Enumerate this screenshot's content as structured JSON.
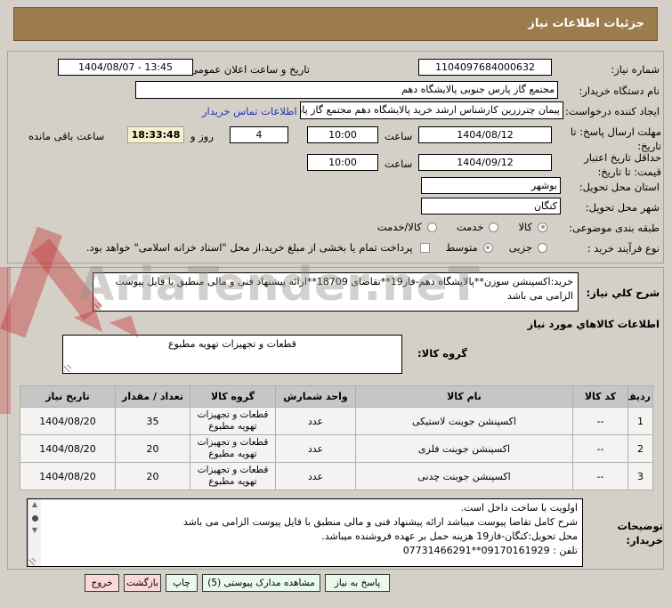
{
  "colors": {
    "header_bg": "#9c7b4c",
    "link_blue": "#2233bb",
    "countdown_highlight": "#f5f0cd",
    "button_green": "#e9f9ec",
    "button_pink": "#fbd9d9",
    "watermark_red": "#c63c3c",
    "table_header_bg": "#c6c6c6"
  },
  "header": {
    "title": "جزئیات اطلاعات نیاز"
  },
  "watermark": {
    "text": "AriaTender.neT"
  },
  "info": {
    "need_number_label": "شماره نیاز:",
    "need_number": "1104097684000632",
    "announce_label": "تاریخ و ساعت اعلان عمومی:",
    "announce_value": "1404/08/07 - 13:45",
    "buyer_org_label": "نام دستگاه خریدار:",
    "buyer_org": "مجتمع گاز پارس جنوبی  پالایشگاه دهم",
    "creator_label": "ایجاد کننده درخواست:",
    "creator": "پیمان چترزرین کارشناس ارشد خرید پالایشگاه دهم مجتمع گاز پارس جنوبی  پالا",
    "contact_link": "اطلاعات تماس خریدار",
    "deadline_label": "مهلت ارسال پاسخ: تا تاریخ:",
    "deadline_date": "1404/08/12",
    "hour_label": "ساعت",
    "deadline_hour": "10:00",
    "days_left": "4",
    "days_suffix": "روز و",
    "countdown": "18:33:48",
    "countdown_suffix": "ساعت باقی مانده",
    "validity_label": "حداقل تاریخ اعتبار قیمت: تا تاریخ:",
    "validity_date": "1404/09/12",
    "validity_hour": "10:00",
    "province_label": "استان محل تحویل:",
    "province": "بوشهر",
    "city_label": "شهر محل تحویل:",
    "city": "کنگان",
    "class_label": "طبقه بندی موضوعی:",
    "class_opt1": "کالا",
    "class_opt2": "خدمت",
    "class_opt3": "کالا/خدمت",
    "class_selected": "کالا",
    "process_label": "نوع فرآیند خرید :",
    "process_opt1": "جزیی",
    "process_opt2": "متوسط",
    "process_selected": "متوسط",
    "treasury_label": "پرداخت تمام یا بخشی از مبلغ خرید،از محل \"اسناد خزانه اسلامی\" خواهد بود."
  },
  "need_desc": {
    "label": "شرح کلي نیاز:",
    "value": "خرید:اکسپنشن سوزن**پالایشگاه دهم-فاز19**تقاضای 18709**ارائه پیشنهاد فنی و مالی منطبق با فایل پیوست الزامی می باشد"
  },
  "goods": {
    "section_title": "اطلاعات کالاهاي مورد نیاز",
    "group_label": "گروه کالا:",
    "group_value": "قطعات و تجهیزات تهویه مطبوع"
  },
  "table": {
    "headers": [
      "ردیف",
      "کد کالا",
      "نام کالا",
      "واحد شمارش",
      "گروه کالا",
      "تعداد / مقدار",
      "تاریخ نیاز"
    ],
    "rows": [
      {
        "row": "1",
        "code": "--",
        "name": "اکسپنشن جوینت لاستیکی",
        "unit": "عدد",
        "group": "قطعات و تجهیزات تهویه مطبوع",
        "qty": "35",
        "date": "1404/08/20"
      },
      {
        "row": "2",
        "code": "--",
        "name": "اکسپنشن جوینت فلزی",
        "unit": "عدد",
        "group": "قطعات و تجهیزات تهویه مطبوع",
        "qty": "20",
        "date": "1404/08/20"
      },
      {
        "row": "3",
        "code": "--",
        "name": "اکسپنشن جوینت چدنی",
        "unit": "عدد",
        "group": "قطعات و تجهیزات تهویه مطبوع",
        "qty": "20",
        "date": "1404/08/20"
      }
    ]
  },
  "notes": {
    "label": "توضیحات خریدار:",
    "value": "اولویت با ساخت داخل است.\nشرح کامل تقاضا پیوست میباشد ارائه پیشنهاد فنی و مالی منطبق با فایل پیوست الزامی می باشد\nمحل تحویل:کنگان-فاز19 هزینه حمل بر عهده فروشنده میباشد.\nتلفن : 09170161929**07731466291"
  },
  "buttons": {
    "reply": "پاسخ به نیاز",
    "docs": "مشاهده مدارک پیوستی (5)",
    "print": "چاپ",
    "back": "بازگشت",
    "exit": "خروج"
  }
}
